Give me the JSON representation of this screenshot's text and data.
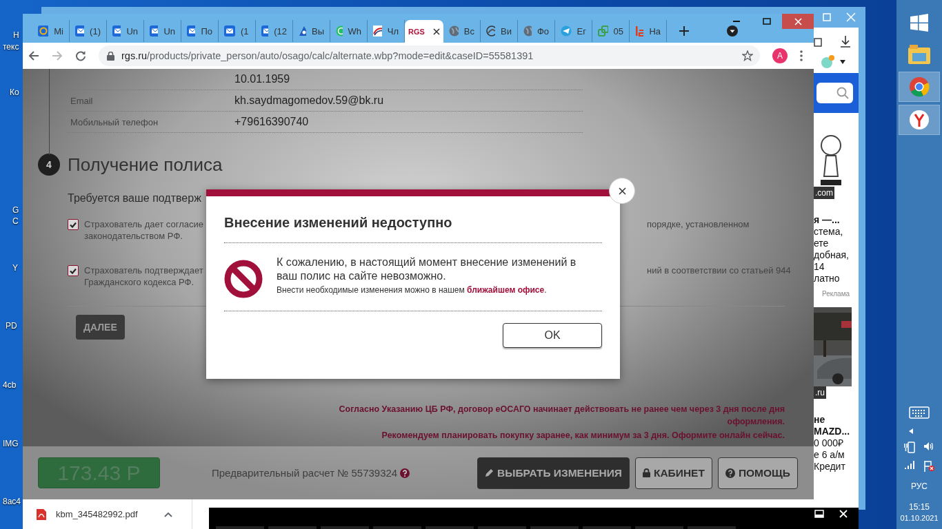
{
  "desktop_icons": [
    {
      "label": "Н"
    },
    {
      "label": "текс"
    },
    {
      "label": "Ко"
    },
    {
      "label": "G"
    },
    {
      "label": "С"
    },
    {
      "label": "Y"
    },
    {
      "label": "PD"
    },
    {
      "label": "4cb"
    },
    {
      "label": "IMG"
    },
    {
      "label": "8ac4"
    }
  ],
  "background_window": {
    "side_texts": [
      {
        "text": ".com",
        "kind": "badge"
      },
      {
        "text": "я —...",
        "kind": "bold"
      },
      {
        "text": "стема,",
        "kind": "plain"
      },
      {
        "text": "ете",
        "kind": "plain"
      },
      {
        "text": "добная,",
        "kind": "plain"
      },
      {
        "text": "14",
        "kind": "plain"
      },
      {
        "text": "латно",
        "kind": "plain"
      },
      {
        "text": "Реклама",
        "kind": "ad"
      },
      {
        "text": ".ru",
        "kind": "badge"
      },
      {
        "text": "не",
        "kind": "bold"
      },
      {
        "text": "MAZD...",
        "kind": "bold"
      },
      {
        "text": "0 000₽",
        "kind": "plain"
      },
      {
        "text": "е 6 а/м",
        "kind": "plain"
      },
      {
        "text": "Кредит",
        "kind": "plain"
      }
    ]
  },
  "browser": {
    "tabs": [
      {
        "label": "Mi",
        "kind": "at",
        "selected": false
      },
      {
        "label": "(1)",
        "kind": "mail",
        "selected": false
      },
      {
        "label": "Un",
        "kind": "mail",
        "selected": false
      },
      {
        "label": "Un",
        "kind": "mail",
        "selected": false
      },
      {
        "label": "По",
        "kind": "mail",
        "selected": false
      },
      {
        "label": "(1",
        "kind": "mail",
        "selected": false
      },
      {
        "label": "(12",
        "kind": "mail",
        "selected": false
      },
      {
        "label": "Вы",
        "kind": "triangle",
        "selected": false
      },
      {
        "label": "Wh",
        "kind": "chat",
        "selected": false
      },
      {
        "label": "Чл",
        "kind": "flag",
        "selected": false
      },
      {
        "label": "RGS",
        "kind": "logo",
        "selected": true
      },
      {
        "label": "Вс",
        "kind": "globe",
        "selected": false
      },
      {
        "label": "Ви",
        "kind": "swirl",
        "selected": false
      },
      {
        "label": "Фо",
        "kind": "globe",
        "selected": false
      },
      {
        "label": "Ег",
        "kind": "plane",
        "selected": false
      },
      {
        "label": "05",
        "kind": "squares",
        "selected": false
      },
      {
        "label": "На",
        "kind": "letters",
        "selected": false
      }
    ],
    "url_host": "rgs.ru",
    "url_path": "/products/private_person/auto/osago/calc/alternate.wbp?mode=edit&caseID=55581391",
    "profile": "A"
  },
  "page": {
    "contact_rows": [
      {
        "value": "10.01.1959"
      },
      {
        "label": "Email",
        "value": "kh.saydmagomedov.59@bk.ru"
      },
      {
        "label": "Мобильный телефон",
        "value": "+79616390740"
      }
    ],
    "step": {
      "number": "4",
      "title": "Получение полиса"
    },
    "confirm_heading": "Требуется ваше подтверж",
    "consents": [
      {
        "checked": true,
        "text_left": "Страхователь дает согласие",
        "text_left_2": "законодательством РФ.",
        "text_right": "порядке, установленном"
      },
      {
        "checked": true,
        "text_left": "Страхователь подтверждает",
        "text_left_2": "Гражданского кодекса РФ.",
        "text_right": "ний в соответствии со статьей 944"
      }
    ],
    "next_button": "ДАЛЕЕ",
    "notices": [
      "Согласно Указанию ЦБ РФ, договор еОСАГО начинает действовать не ранее чем через 3 дня после дня",
      "оформления.",
      "Рекомендуем планировать покупку заранее, как минимум за 3 дня. Оформите онлайн сейчас."
    ],
    "price": "173.43 Р",
    "calc_label": "Предварительный расчет № 55739324",
    "actions": [
      {
        "label": "ВЫБРАТЬ ИЗМЕНЕНИЯ",
        "kind": "edit"
      },
      {
        "label": "КАБИНЕТ",
        "kind": "lock"
      },
      {
        "label": "ПОМОЩЬ",
        "kind": "help"
      }
    ]
  },
  "dialog": {
    "title": "Внесение изменений недоступно",
    "message": "К сожалению, в настоящий момент внесение изменений в ваш полис на сайте невозможно.",
    "hint": "Внести необходимые изменения можно в нашем",
    "hint_link": "ближайшем офисе",
    "hint_end": ".",
    "ok_button": "OK"
  },
  "downloads": {
    "file": "kbm_345482992.pdf"
  },
  "taskbar": {
    "language": "РУС",
    "time": "15:15",
    "date": "01.10.2021"
  }
}
